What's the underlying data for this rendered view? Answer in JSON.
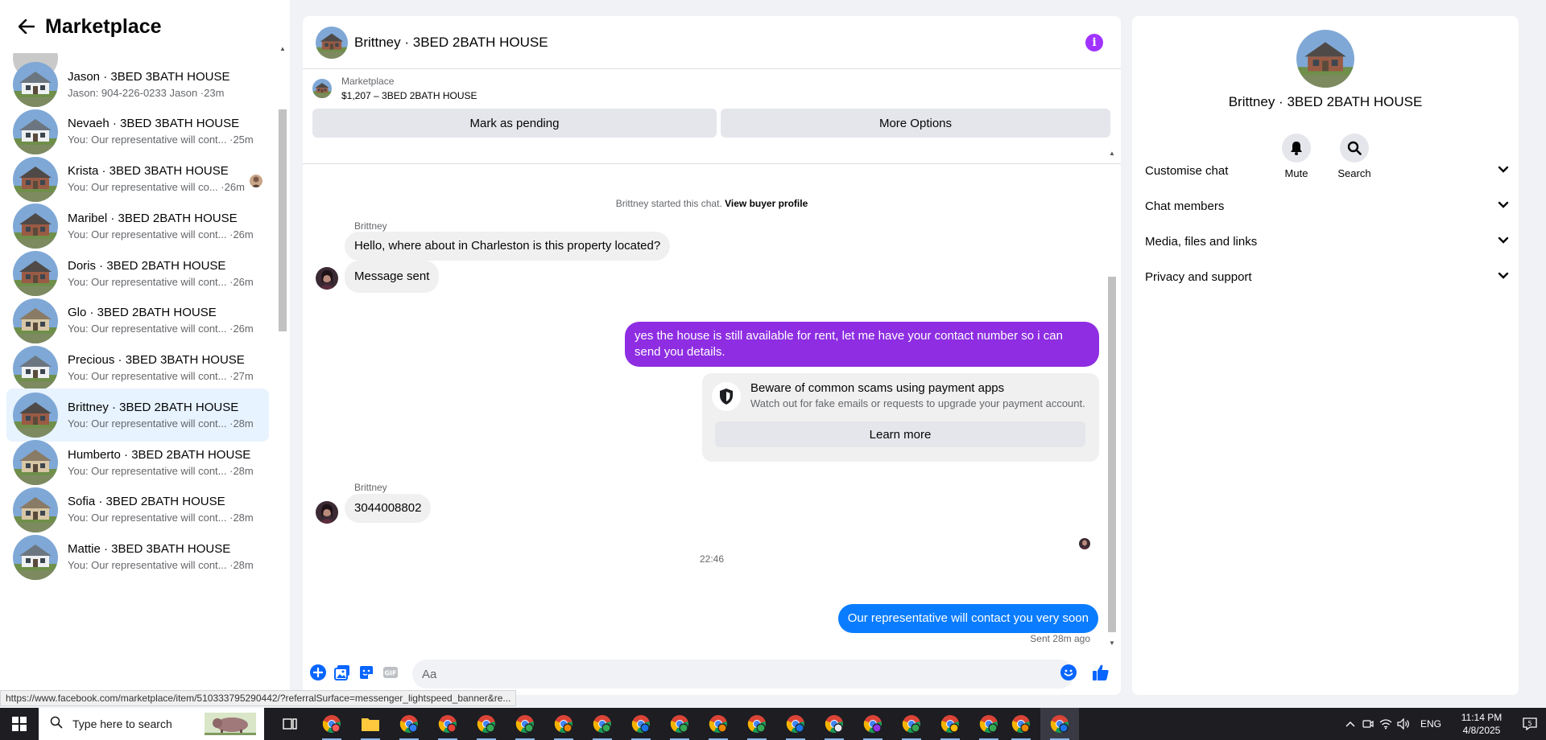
{
  "sidebar": {
    "title": "Marketplace",
    "conversations": [
      {
        "name": "Jason · 3BED 3BATH HOUSE",
        "preview": "Jason: 904-226-0233 Jason ·23m",
        "house": "white"
      },
      {
        "name": "Nevaeh · 3BED 3BATH HOUSE",
        "preview": "You: Our representative will cont... ·25m",
        "house": "white"
      },
      {
        "name": "Krista · 3BED 3BATH HOUSE",
        "preview": "You: Our representative will co... ·26m",
        "house": "brick"
      },
      {
        "name": "Maribel · 3BED 2BATH HOUSE",
        "preview": "You: Our representative will cont... ·26m",
        "house": "brick"
      },
      {
        "name": "Doris · 3BED 2BATH HOUSE",
        "preview": "You: Our representative will cont... ·26m",
        "house": "brick"
      },
      {
        "name": "Glo · 3BED 2BATH HOUSE",
        "preview": "You: Our representative will cont... ·26m",
        "house": "beige"
      },
      {
        "name": "Precious · 3BED 3BATH HOUSE",
        "preview": "You: Our representative will cont... ·27m",
        "house": "white"
      },
      {
        "name": "Brittney · 3BED 2BATH HOUSE",
        "preview": "You: Our representative will cont... ·28m",
        "house": "brick"
      },
      {
        "name": "Humberto · 3BED 2BATH HOUSE",
        "preview": "You: Our representative will cont... ·28m",
        "house": "beige"
      },
      {
        "name": "Sofia · 3BED 2BATH HOUSE",
        "preview": "You: Our representative will cont... ·28m",
        "house": "beige"
      },
      {
        "name": "Mattie · 3BED 3BATH HOUSE",
        "preview": "You: Our representative will cont... ·28m",
        "house": "white"
      }
    ]
  },
  "chat": {
    "title": "Brittney · 3BED 2BATH HOUSE",
    "listing": {
      "source": "Marketplace",
      "title": "$1,207 – 3BED 2BATH HOUSE"
    },
    "buttons": {
      "pending": "Mark as pending",
      "more": "More Options"
    },
    "system_line": {
      "text": "Brittney started this chat. ",
      "link": "View buyer profile"
    },
    "messages": [
      {
        "sender": "Brittney",
        "text": "Hello, where about in Charleston is this property located?"
      },
      {
        "text": "Message sent"
      },
      {
        "text": "yes the house is still available for rent, let me have your contact number so i can send you details."
      },
      {
        "sender": "Brittney",
        "text": "3044008802"
      },
      {
        "text": "Our representative will contact you very soon"
      }
    ],
    "warning": {
      "title": "Beware of common scams using payment apps",
      "subtitle": "Watch out for fake emails or requests to upgrade your payment account.",
      "button": "Learn more"
    },
    "timestamp": "22:46",
    "sent_status": "Sent 28m ago",
    "composer_placeholder": "Aa"
  },
  "details": {
    "name": "Brittney · 3BED 2BATH HOUSE",
    "actions": {
      "mute": "Mute",
      "search": "Search"
    },
    "sections": [
      "Customise chat",
      "Chat members",
      "Media, files and links",
      "Privacy and support"
    ]
  },
  "status_url": "https://www.facebook.com/marketplace/item/510333795290442/?referralSurface=messenger_lightspeed_banner&re...",
  "taskbar": {
    "search_placeholder": "Type here to search",
    "language": "ENG",
    "time": "11:14 PM",
    "date": "4/8/2025"
  },
  "colors": {
    "accent_purple": "#a033ff",
    "bubble_purple": "#8e2de2",
    "bubble_blue": "#0a7cff",
    "active_item": "#e7f3ff"
  }
}
